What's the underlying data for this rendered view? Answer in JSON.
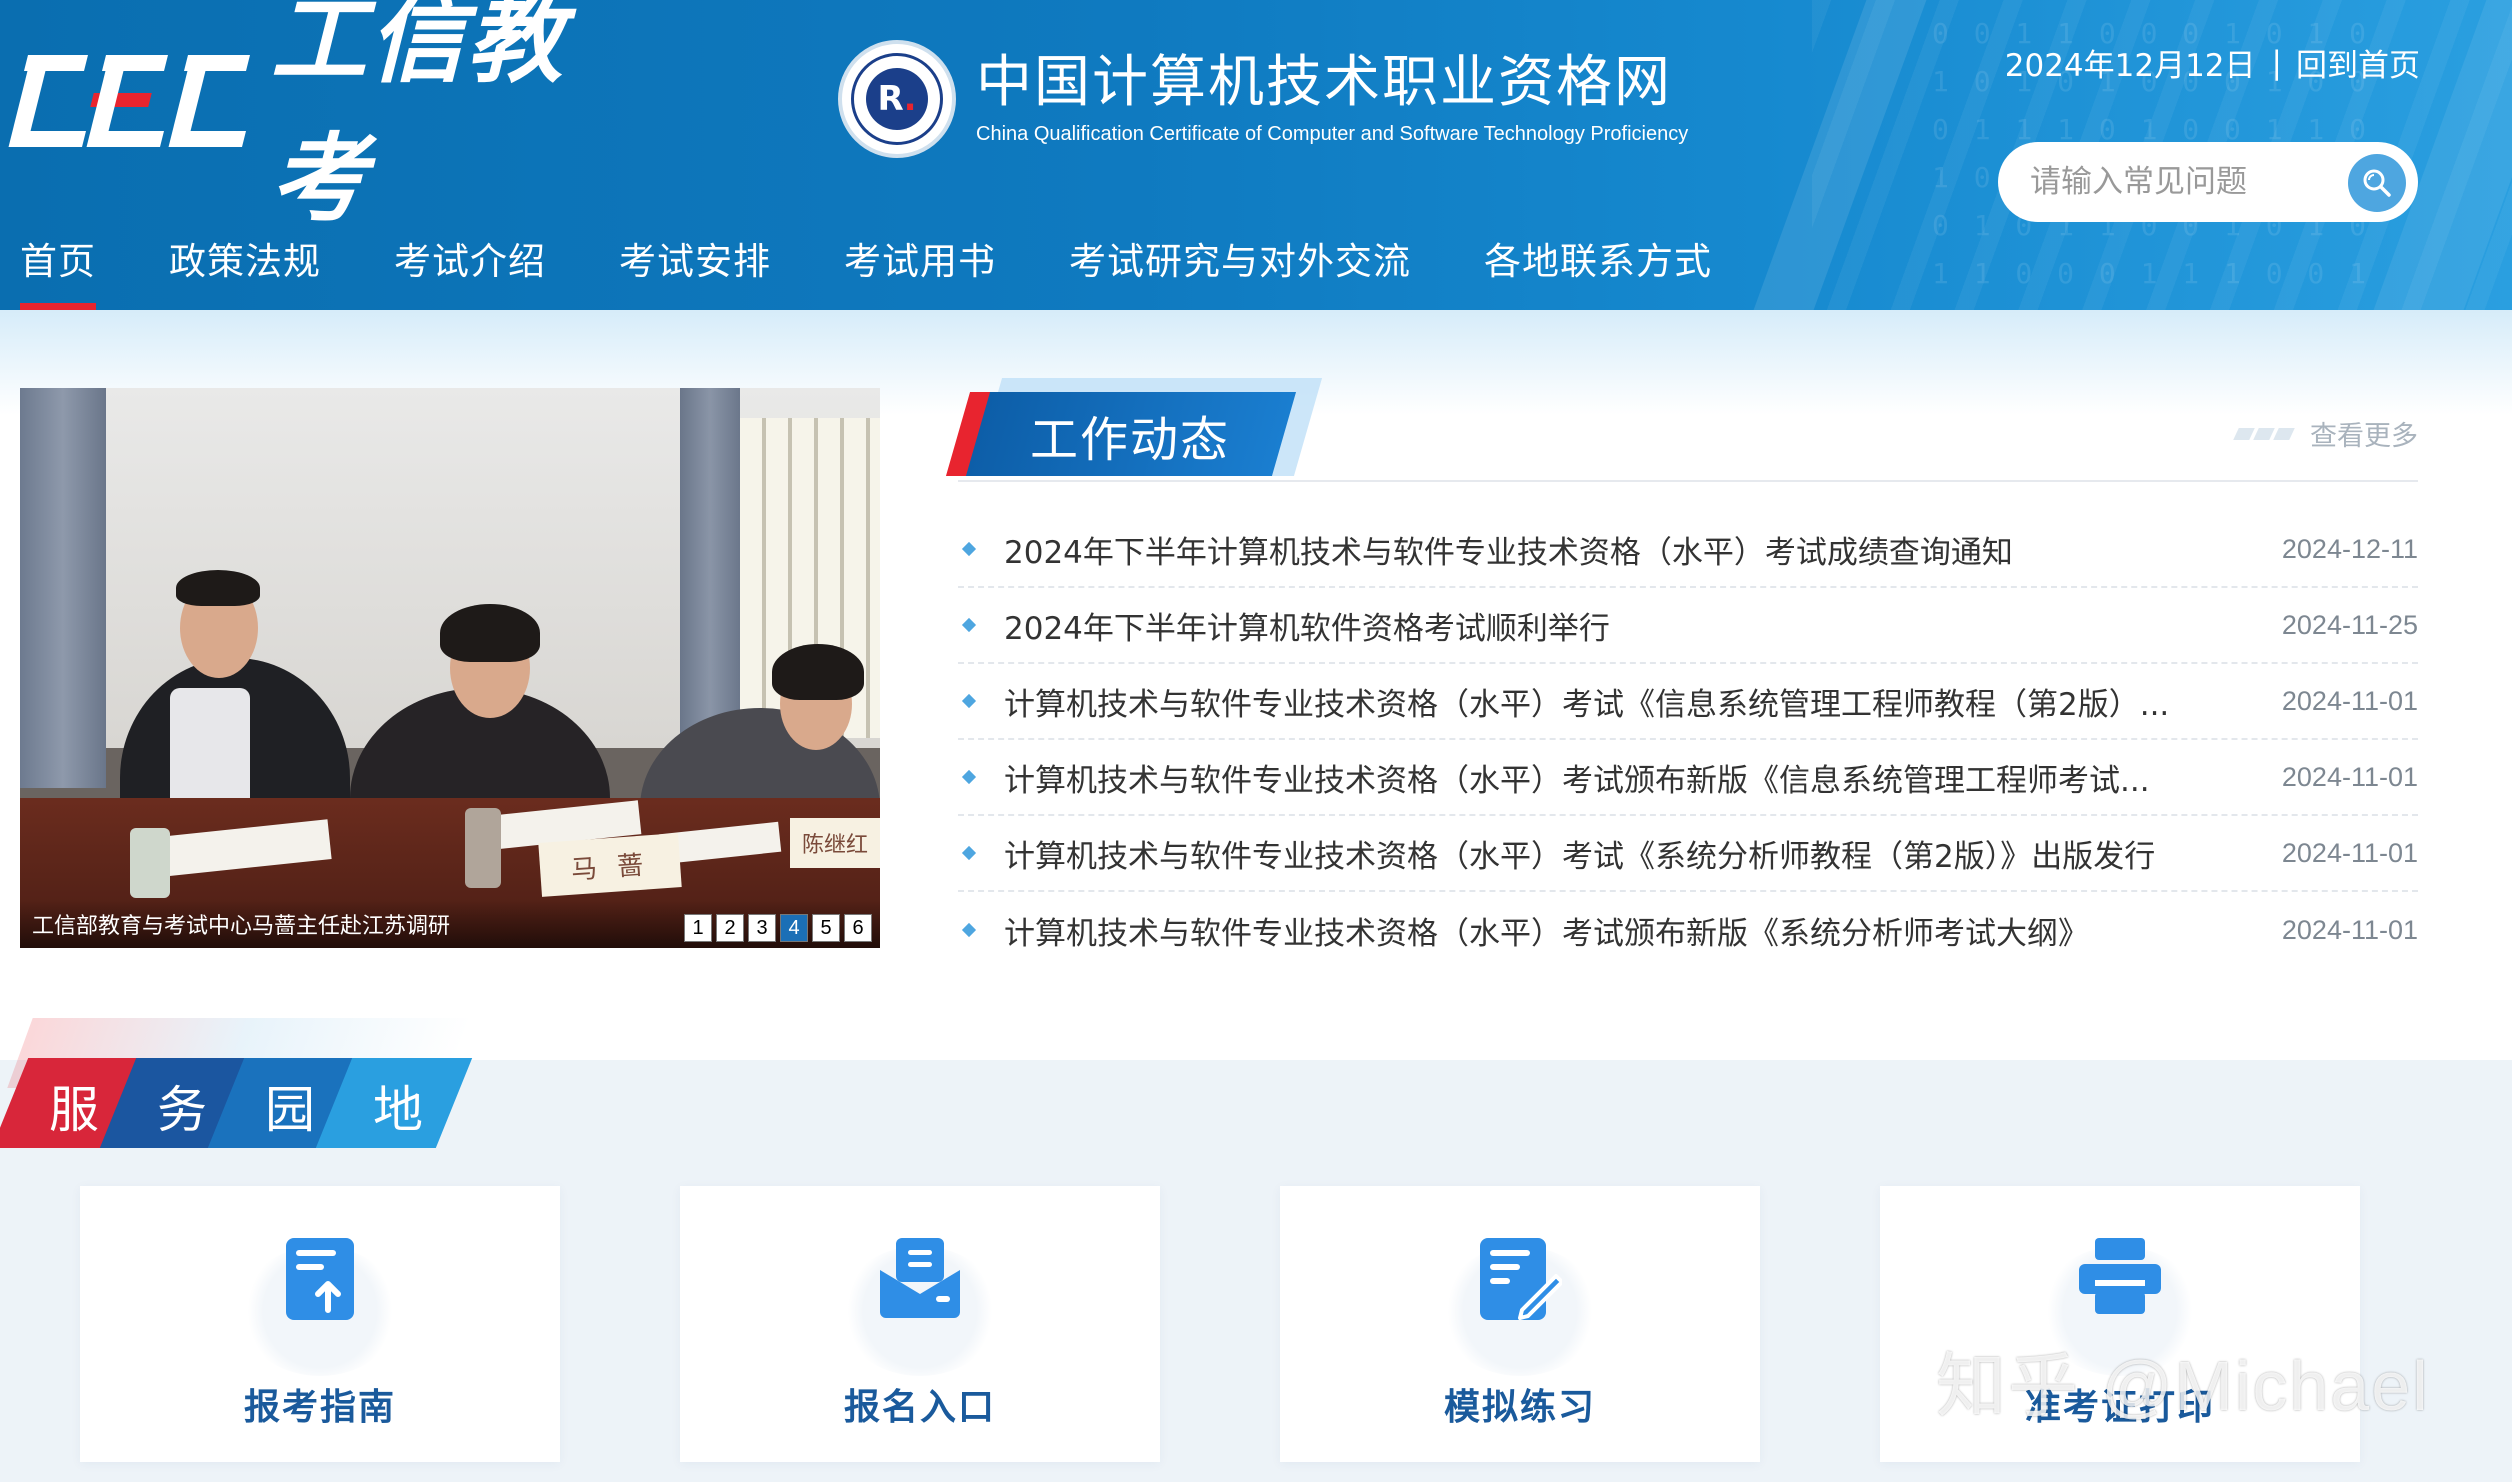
{
  "header": {
    "logo_text": "工信教考",
    "logo_mark": "CEC",
    "site_title_cn": "中国计算机技术职业资格网",
    "site_title_en": "China Qualification Certificate of Computer and Software Technology Proficiency",
    "date": "2024年12月12日",
    "separator": "|",
    "home_link": "回到首页",
    "search_placeholder": "请输入常见问题"
  },
  "nav": {
    "items": [
      {
        "label": "首页"
      },
      {
        "label": "政策法规"
      },
      {
        "label": "考试介绍"
      },
      {
        "label": "考试安排"
      },
      {
        "label": "考试用书"
      },
      {
        "label": "考试研究与对外交流"
      },
      {
        "label": "各地联系方式"
      }
    ],
    "active_index": 0
  },
  "carousel": {
    "caption": "工信部教育与考试中心马蔷主任赴江苏调研",
    "name_cards": [
      "马 蔷",
      "陈继红"
    ],
    "pages": [
      "1",
      "2",
      "3",
      "4",
      "5",
      "6"
    ],
    "active_page": "4"
  },
  "news": {
    "section_title": "工作动态",
    "more_label": "查看更多",
    "items": [
      {
        "title": "2024年下半年计算机技术与软件专业技术资格（水平）考试成绩查询通知",
        "date": "2024-12-11"
      },
      {
        "title": "2024年下半年计算机软件资格考试顺利举行",
        "date": "2024-11-25"
      },
      {
        "title": "计算机技术与软件专业技术资格（水平）考试《信息系统管理工程师教程（第2版）...",
        "date": "2024-11-01"
      },
      {
        "title": "计算机技术与软件专业技术资格（水平）考试颁布新版《信息系统管理工程师考试...",
        "date": "2024-11-01"
      },
      {
        "title": "计算机技术与软件专业技术资格（水平）考试《系统分析师教程（第2版）》出版发行",
        "date": "2024-11-01"
      },
      {
        "title": "计算机技术与软件专业技术资格（水平）考试颁布新版《系统分析师考试大纲》",
        "date": "2024-11-01"
      }
    ]
  },
  "service": {
    "title_chars": [
      "服",
      "务",
      "园",
      "地"
    ],
    "cards": [
      {
        "label": "报考指南",
        "icon": "upload-document-icon"
      },
      {
        "label": "报名入口",
        "icon": "envelope-inbox-icon"
      },
      {
        "label": "模拟练习",
        "icon": "edit-document-icon"
      },
      {
        "label": "准考证打印",
        "icon": "printer-icon"
      }
    ]
  },
  "watermark": "知乎 @Michael",
  "colors": {
    "header_blue": "#0f7ac0",
    "accent_red": "#e8242f",
    "card_label_blue": "#1a5a9c",
    "icon_blue": "#2f8ee6"
  }
}
